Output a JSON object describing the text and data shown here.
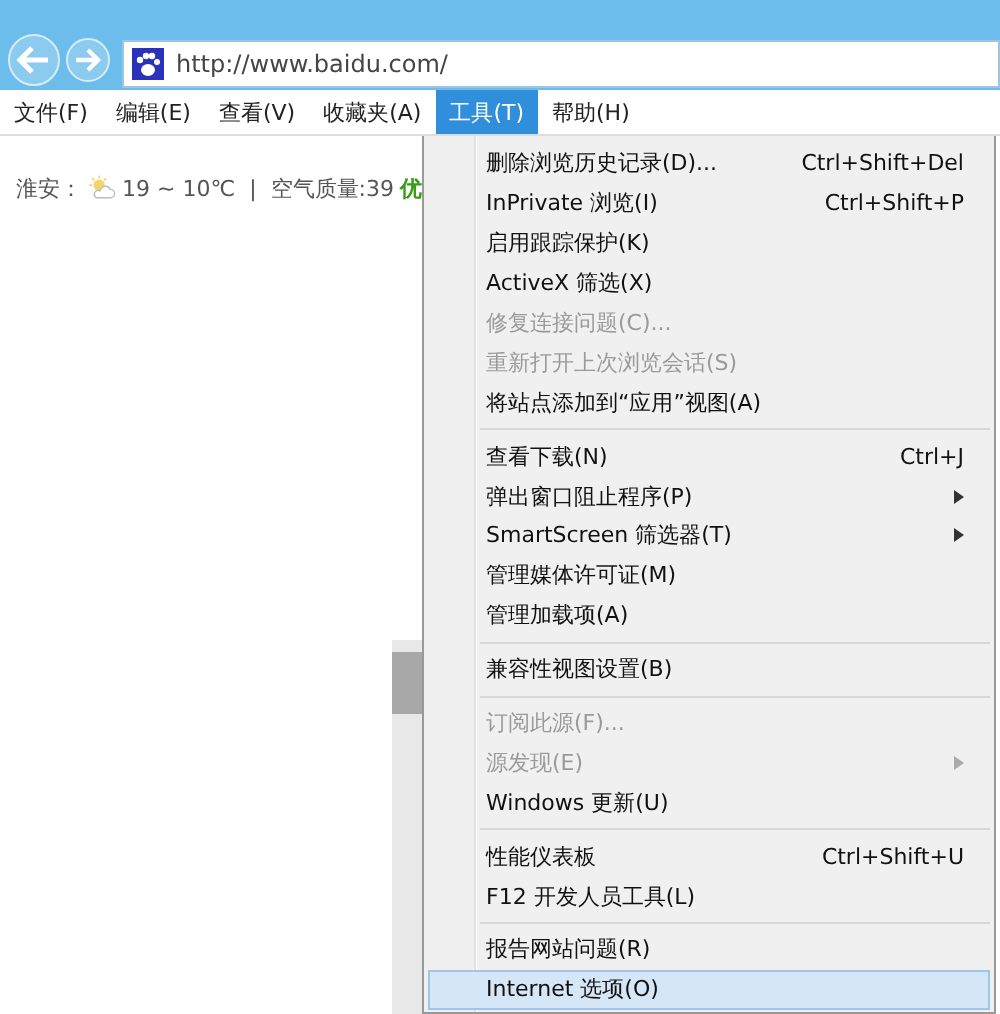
{
  "address_bar": {
    "url": "http://www.baidu.com/"
  },
  "menu_bar": [
    {
      "label": "文件(F)",
      "selected": false
    },
    {
      "label": "编辑(E)",
      "selected": false
    },
    {
      "label": "查看(V)",
      "selected": false
    },
    {
      "label": "收藏夹(A)",
      "selected": false
    },
    {
      "label": "工具(T)",
      "selected": true
    },
    {
      "label": "帮助(H)",
      "selected": false
    }
  ],
  "weather": {
    "city": "淮安：",
    "temperature": "19 ~ 10℃",
    "divider": "|",
    "air_quality": "空气质量:39",
    "air_grade": "优"
  },
  "tools_menu": [
    {
      "kind": "item",
      "label": "删除浏览历史记录(D)...",
      "shortcut": "Ctrl+Shift+Del",
      "disabled": false,
      "submenu": false,
      "selected": false
    },
    {
      "kind": "item",
      "label": "InPrivate 浏览(I)",
      "shortcut": "Ctrl+Shift+P",
      "disabled": false,
      "submenu": false,
      "selected": false
    },
    {
      "kind": "item",
      "label": "启用跟踪保护(K)",
      "disabled": false,
      "submenu": false,
      "selected": false
    },
    {
      "kind": "item",
      "label": "ActiveX 筛选(X)",
      "disabled": false,
      "submenu": false,
      "selected": false
    },
    {
      "kind": "item",
      "label": "修复连接问题(C)...",
      "disabled": true,
      "submenu": false,
      "selected": false
    },
    {
      "kind": "item",
      "label": "重新打开上次浏览会话(S)",
      "disabled": true,
      "submenu": false,
      "selected": false
    },
    {
      "kind": "item",
      "label": "将站点添加到“应用”视图(A)",
      "disabled": false,
      "submenu": false,
      "selected": false
    },
    {
      "kind": "separator"
    },
    {
      "kind": "item",
      "label": "查看下载(N)",
      "shortcut": "Ctrl+J",
      "disabled": false,
      "submenu": false,
      "selected": false
    },
    {
      "kind": "item",
      "label": "弹出窗口阻止程序(P)",
      "disabled": false,
      "submenu": true,
      "selected": false
    },
    {
      "kind": "item",
      "label": "SmartScreen 筛选器(T)",
      "disabled": false,
      "submenu": true,
      "selected": false
    },
    {
      "kind": "item",
      "label": "管理媒体许可证(M)",
      "disabled": false,
      "submenu": false,
      "selected": false
    },
    {
      "kind": "item",
      "label": "管理加载项(A)",
      "disabled": false,
      "submenu": false,
      "selected": false
    },
    {
      "kind": "separator"
    },
    {
      "kind": "item",
      "label": "兼容性视图设置(B)",
      "disabled": false,
      "submenu": false,
      "selected": false
    },
    {
      "kind": "separator"
    },
    {
      "kind": "item",
      "label": "订阅此源(F)...",
      "disabled": true,
      "submenu": false,
      "selected": false
    },
    {
      "kind": "item",
      "label": "源发现(E)",
      "disabled": true,
      "submenu": true,
      "selected": false
    },
    {
      "kind": "item",
      "label": "Windows 更新(U)",
      "disabled": false,
      "submenu": false,
      "selected": false
    },
    {
      "kind": "separator"
    },
    {
      "kind": "item",
      "label": "性能仪表板",
      "shortcut": "Ctrl+Shift+U",
      "disabled": false,
      "submenu": false,
      "selected": false
    },
    {
      "kind": "item",
      "label": "F12 开发人员工具(L)",
      "disabled": false,
      "submenu": false,
      "selected": false
    },
    {
      "kind": "separator"
    },
    {
      "kind": "item",
      "label": "报告网站问题(R)",
      "disabled": false,
      "submenu": false,
      "selected": false
    },
    {
      "kind": "item",
      "label": "Internet 选项(O)",
      "disabled": false,
      "submenu": false,
      "selected": true
    }
  ]
}
